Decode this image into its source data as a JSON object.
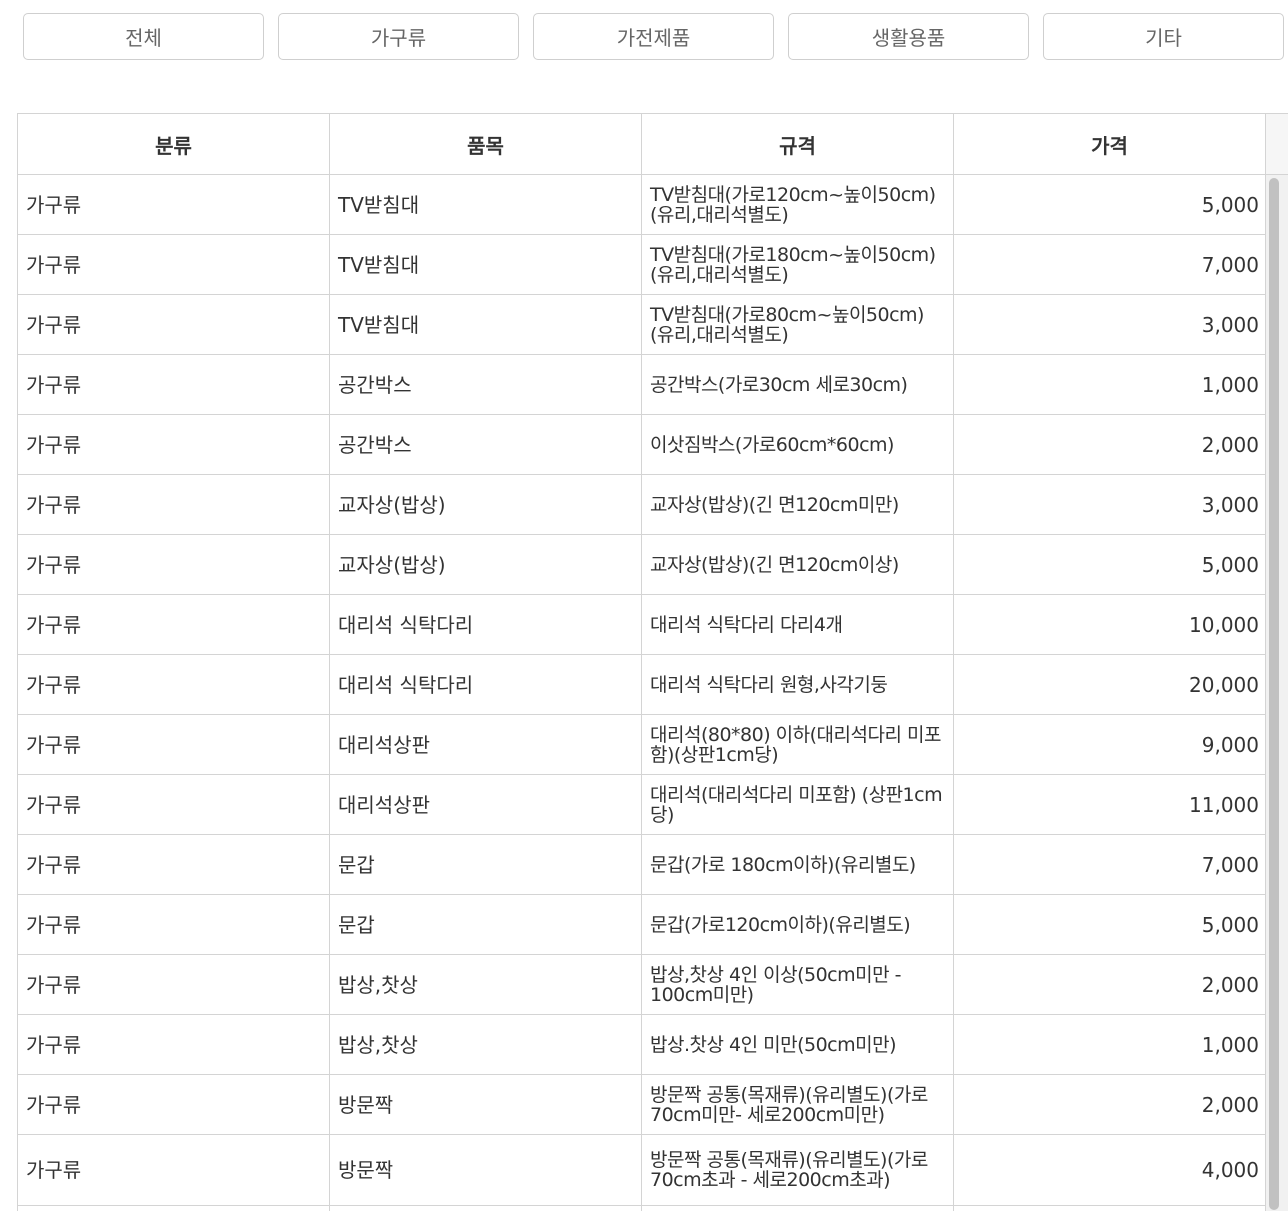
{
  "filters": [
    "전체",
    "가구류",
    "가전제품",
    "생활용품",
    "기타"
  ],
  "table": {
    "headers": [
      "분류",
      "품목",
      "규격",
      "가격"
    ],
    "rows": [
      {
        "category": "가구류",
        "item": "TV받침대",
        "spec": "TV받침대(가로120cm~높이50cm)(유리,대리석별도)",
        "price": "5,000"
      },
      {
        "category": "가구류",
        "item": "TV받침대",
        "spec": "TV받침대(가로180cm~높이50cm)(유리,대리석별도)",
        "price": "7,000"
      },
      {
        "category": "가구류",
        "item": "TV받침대",
        "spec": "TV받침대(가로80cm~높이50cm)(유리,대리석별도)",
        "price": "3,000"
      },
      {
        "category": "가구류",
        "item": "공간박스",
        "spec": "공간박스(가로30cm 세로30cm)",
        "price": "1,000"
      },
      {
        "category": "가구류",
        "item": "공간박스",
        "spec": "이삿짐박스(가로60cm*60cm)",
        "price": "2,000"
      },
      {
        "category": "가구류",
        "item": "교자상(밥상)",
        "spec": "교자상(밥상)(긴 면120cm미만)",
        "price": "3,000"
      },
      {
        "category": "가구류",
        "item": "교자상(밥상)",
        "spec": "교자상(밥상)(긴 면120cm이상)",
        "price": "5,000"
      },
      {
        "category": "가구류",
        "item": "대리석 식탁다리",
        "spec": "대리석 식탁다리 다리4개",
        "price": "10,000"
      },
      {
        "category": "가구류",
        "item": "대리석 식탁다리",
        "spec": "대리석 식탁다리 원형,사각기둥",
        "price": "20,000"
      },
      {
        "category": "가구류",
        "item": "대리석상판",
        "spec": "대리석(80*80) 이하(대리석다리 미포함)(상판1cm당)",
        "price": "9,000"
      },
      {
        "category": "가구류",
        "item": "대리석상판",
        "spec": "대리석(대리석다리 미포함) (상판1cm당)",
        "price": "11,000"
      },
      {
        "category": "가구류",
        "item": "문갑",
        "spec": "문갑(가로 180cm이하)(유리별도)",
        "price": "7,000"
      },
      {
        "category": "가구류",
        "item": "문갑",
        "spec": "문갑(가로120cm이하)(유리별도)",
        "price": "5,000"
      },
      {
        "category": "가구류",
        "item": "밥상,찻상",
        "spec": "밥상,찻상 4인 이상(50cm미만 - 100cm미만)",
        "price": "2,000"
      },
      {
        "category": "가구류",
        "item": "밥상,찻상",
        "spec": "밥상.찻상 4인 미만(50cm미만)",
        "price": "1,000"
      },
      {
        "category": "가구류",
        "item": "방문짝",
        "spec": "방문짝 공통(목재류)(유리별도)(가로70cm미만- 세로200cm미만)",
        "price": "2,000"
      },
      {
        "category": "가구류",
        "item": "방문짝",
        "spec": "방문짝 공통(목재류)(유리별도)(가로70cm초과 - 세로200cm초과)",
        "price": "4,000"
      }
    ]
  }
}
